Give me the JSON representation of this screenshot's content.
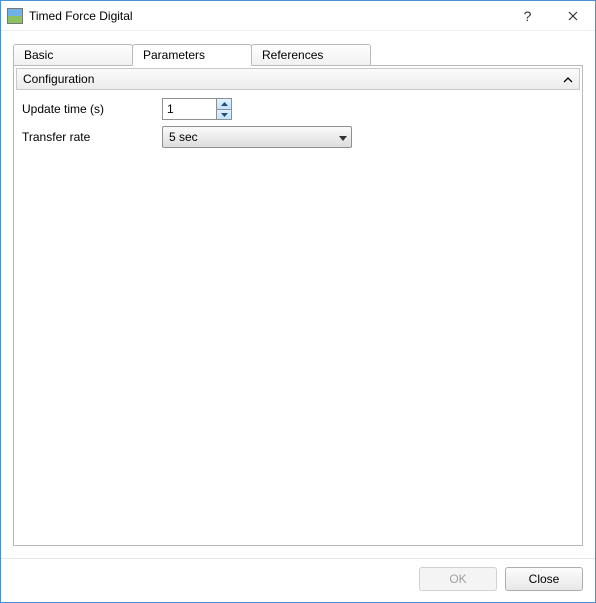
{
  "window": {
    "title": "Timed Force Digital"
  },
  "tabs": {
    "basic": "Basic",
    "parameters": "Parameters",
    "references": "References",
    "active": "Parameters"
  },
  "group": {
    "configuration_label": "Configuration"
  },
  "fields": {
    "update_time": {
      "label": "Update time (s)",
      "value": "1"
    },
    "transfer_rate": {
      "label": "Transfer rate",
      "value": "5 sec"
    }
  },
  "buttons": {
    "ok": "OK",
    "close": "Close"
  }
}
